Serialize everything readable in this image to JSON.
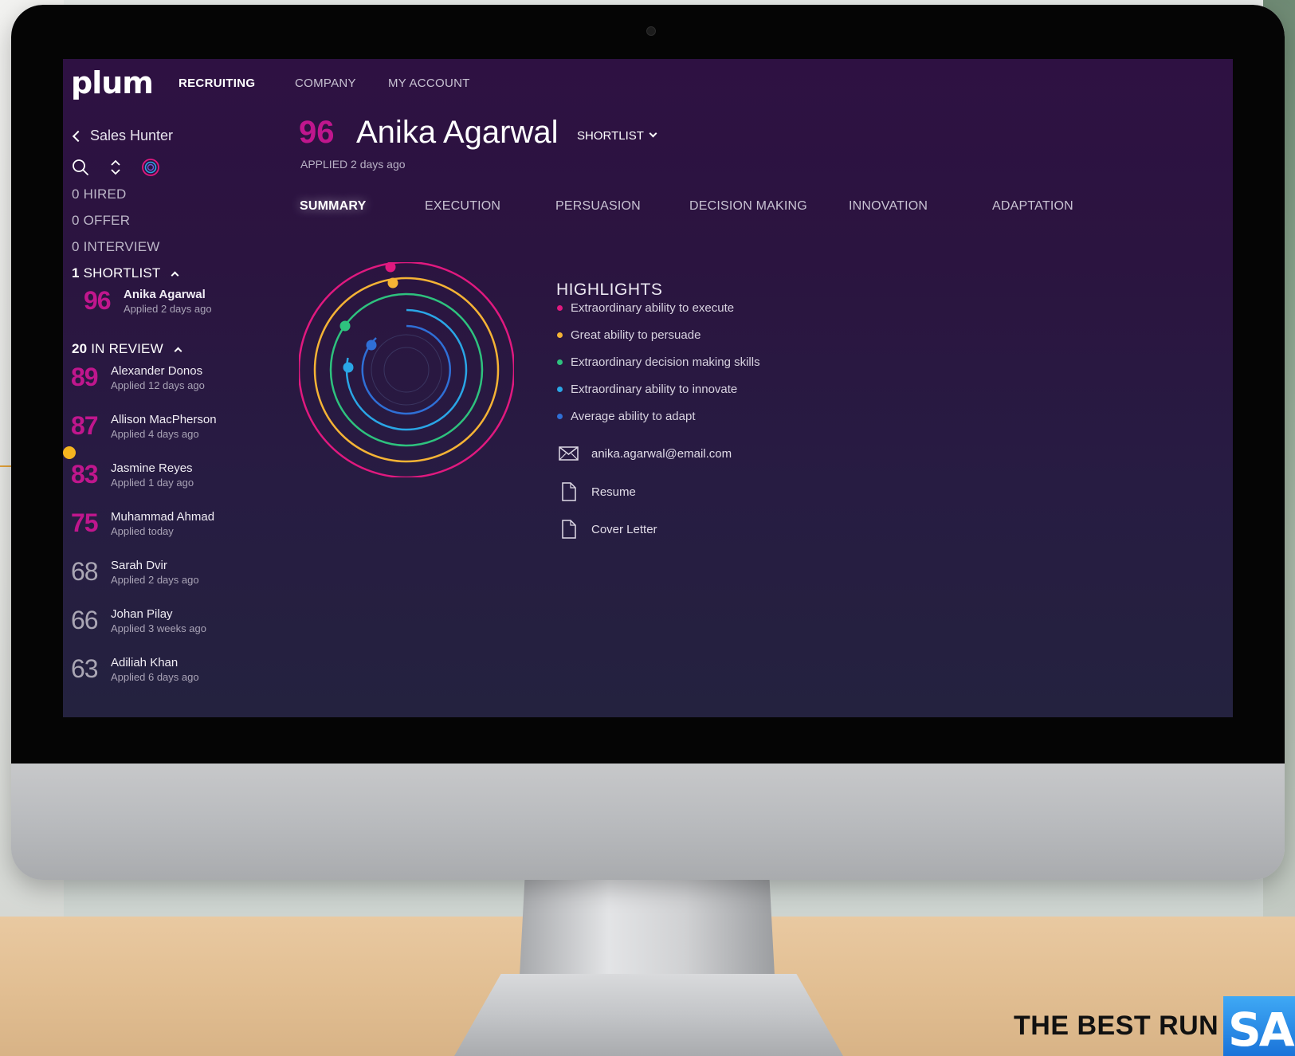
{
  "app": {
    "logo": "plum",
    "nav": [
      "RECRUITING",
      "COMPANY",
      "MY ACCOUNT"
    ]
  },
  "sidebar": {
    "back_label": "Sales Hunter",
    "stages": {
      "hired": {
        "count": "0",
        "label": "HIRED"
      },
      "offer": {
        "count": "0",
        "label": "OFFER"
      },
      "interview": {
        "count": "0",
        "label": "INTERVIEW"
      },
      "shortlist": {
        "count": "1",
        "label": "SHORTLIST"
      },
      "in_review": {
        "count": "20",
        "label": "IN REVIEW"
      }
    },
    "shortlist_candidates": [
      {
        "score": "96",
        "name": "Anika Agarwal",
        "applied": "Applied 2 days ago"
      }
    ],
    "review_candidates": [
      {
        "score": "89",
        "name": "Alexander Donos",
        "applied": "Applied 12 days ago"
      },
      {
        "score": "87",
        "name": "Allison MacPherson",
        "applied": "Applied 4 days ago"
      },
      {
        "score": "83",
        "name": "Jasmine Reyes",
        "applied": "Applied 1 day ago"
      },
      {
        "score": "75",
        "name": "Muhammad Ahmad",
        "applied": "Applied today"
      },
      {
        "score": "68",
        "name": "Sarah Dvir",
        "applied": "Applied 2 days ago"
      },
      {
        "score": "66",
        "name": "Johan Pilay",
        "applied": "Applied 3 weeks ago"
      },
      {
        "score": "63",
        "name": "Adiliah Khan",
        "applied": "Applied 6 days ago"
      }
    ]
  },
  "candidate": {
    "score": "96",
    "name": "Anika Agarwal",
    "status": "SHORTLIST",
    "applied": "APPLIED 2 days ago"
  },
  "tabs": [
    "SUMMARY",
    "EXECUTION",
    "PERSUASION",
    "DECISION MAKING",
    "INNOVATION",
    "ADAPTATION"
  ],
  "highlights": {
    "title": "HIGHLIGHTS",
    "items": [
      {
        "text": "Extraordinary ability to execute",
        "color": "#e0197f"
      },
      {
        "text": "Great ability to persuade",
        "color": "#f5b335"
      },
      {
        "text": "Extraordinary decision making skills",
        "color": "#2ec27e"
      },
      {
        "text": "Extraordinary ability to innovate",
        "color": "#2aa6e6"
      },
      {
        "text": "Average ability to adapt",
        "color": "#2f6fd6"
      }
    ]
  },
  "links": {
    "email": "anika.agarwal@email.com",
    "resume": "Resume",
    "cover_letter": "Cover Letter"
  },
  "branding": {
    "slogan": "THE BEST RUN",
    "sap": "SAP"
  },
  "colors": {
    "accent": "#c0168d",
    "screen_bg": "#2b1440"
  }
}
